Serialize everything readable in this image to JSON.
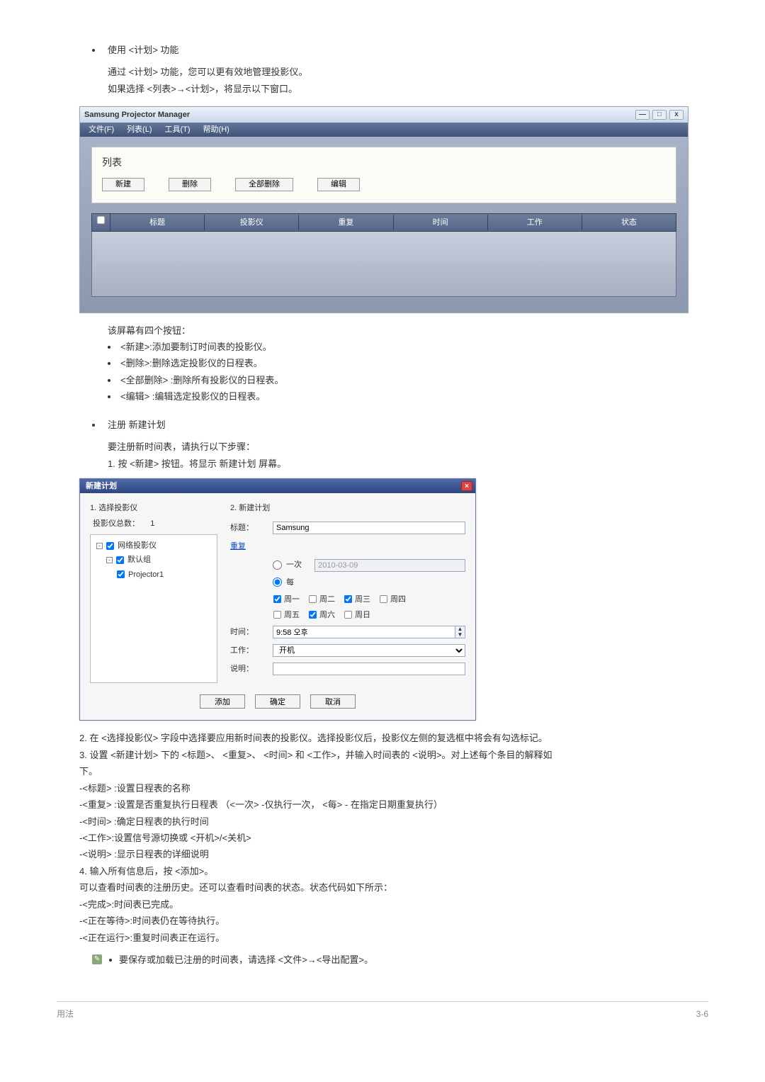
{
  "intro": {
    "line1": "使用 <计划> 功能",
    "line2": "通过 <计划> 功能，您可以更有效地管理投影仪。",
    "line3": "如果选择 <列表>→<计划>，将显示以下窗口。"
  },
  "app1": {
    "title": "Samsung Projector Manager",
    "win": {
      "min": "—",
      "max": "□",
      "close": "x"
    },
    "menu": [
      "文件(F)",
      "列表(L)",
      "工具(T)",
      "帮助(H)"
    ],
    "panel_title": "列表",
    "buttons": {
      "new": "新建",
      "delete": "删除",
      "delete_all": "全部删除",
      "edit": "编辑"
    },
    "columns": [
      "标题",
      "投影仪",
      "重复",
      "时间",
      "工作",
      "状态"
    ]
  },
  "after_app1": {
    "lead": "该屏幕有四个按钮：",
    "items": [
      "<新建>:添加要制订时间表的投影仪。",
      "<删除>:删除选定投影仪的日程表。",
      "<全部删除> :删除所有投影仪的日程表。",
      "<编辑> :编辑选定投影仪的日程表。"
    ]
  },
  "reg": {
    "heading": "注册 新建计划",
    "line1": "要注册新时间表，请执行以下步骤：",
    "line2": "1. 按 <新建> 按钮。将显示 新建计划 屏幕。"
  },
  "dlg": {
    "title": "新建计划",
    "left": {
      "title": "1. 选择投影仪",
      "count_label": "投影仪总数：",
      "count_value": "1",
      "tree": {
        "root": "网络投影仪",
        "group": "默认组",
        "item": "Projector1"
      }
    },
    "right": {
      "title": "2. 新建计划",
      "labels": {
        "title": "标题：",
        "repeat": "重复",
        "once": "一次",
        "every": "每",
        "time": "时间：",
        "work": "工作：",
        "desc": "说明："
      },
      "values": {
        "title": "Samsung",
        "date": "2010-03-09",
        "time": "9:58 오후",
        "work": "开机",
        "desc": ""
      },
      "days": {
        "mon": "周一",
        "tue": "周二",
        "wed": "周三",
        "thu": "周四",
        "fri": "周五",
        "sat": "周六",
        "sun": "周日"
      }
    },
    "buttons": {
      "add": "添加",
      "ok": "确定",
      "cancel": "取消"
    }
  },
  "after_dlg": {
    "p2": "2. 在 <选择投影仪> 字段中选择要应用新时间表的投影仪。选择投影仪后，投影仪左侧的复选框中将会有勾选标记。",
    "p3a": "3. 设置 <新建计划> 下的 <标题>、 <重复>、 <时间> 和 <工作>，并输入时间表的 <说明>。对上述每个条目的解释如",
    "p3b": "下。",
    "d1": "-<标题> :设置日程表的名称",
    "d2": "-<重复> :设置是否重复执行日程表 （<一次> -仅执行一次， <每> - 在指定日期重复执行）",
    "d3": "-<时间> :确定日程表的执行时间",
    "d4": "-<工作>:设置信号源切换或 <开机>/<关机>",
    "d5": "-<说明> :显示日程表的详细说明",
    "p4": "4. 输入所有信息后，按 <添加>。",
    "p5": "可以查看时间表的注册历史。还可以查看时间表的状态。状态代码如下所示：",
    "s1": "-<完成>:时间表已完成。",
    "s2": "-<正在等待>:时间表仍在等待执行。",
    "s3": "-<正在运行>:重复时间表正在运行。"
  },
  "note": "要保存或加载已注册的时间表，请选择 <文件>→<导出配置>。",
  "footer": {
    "left": "用法",
    "right": "3-6"
  }
}
